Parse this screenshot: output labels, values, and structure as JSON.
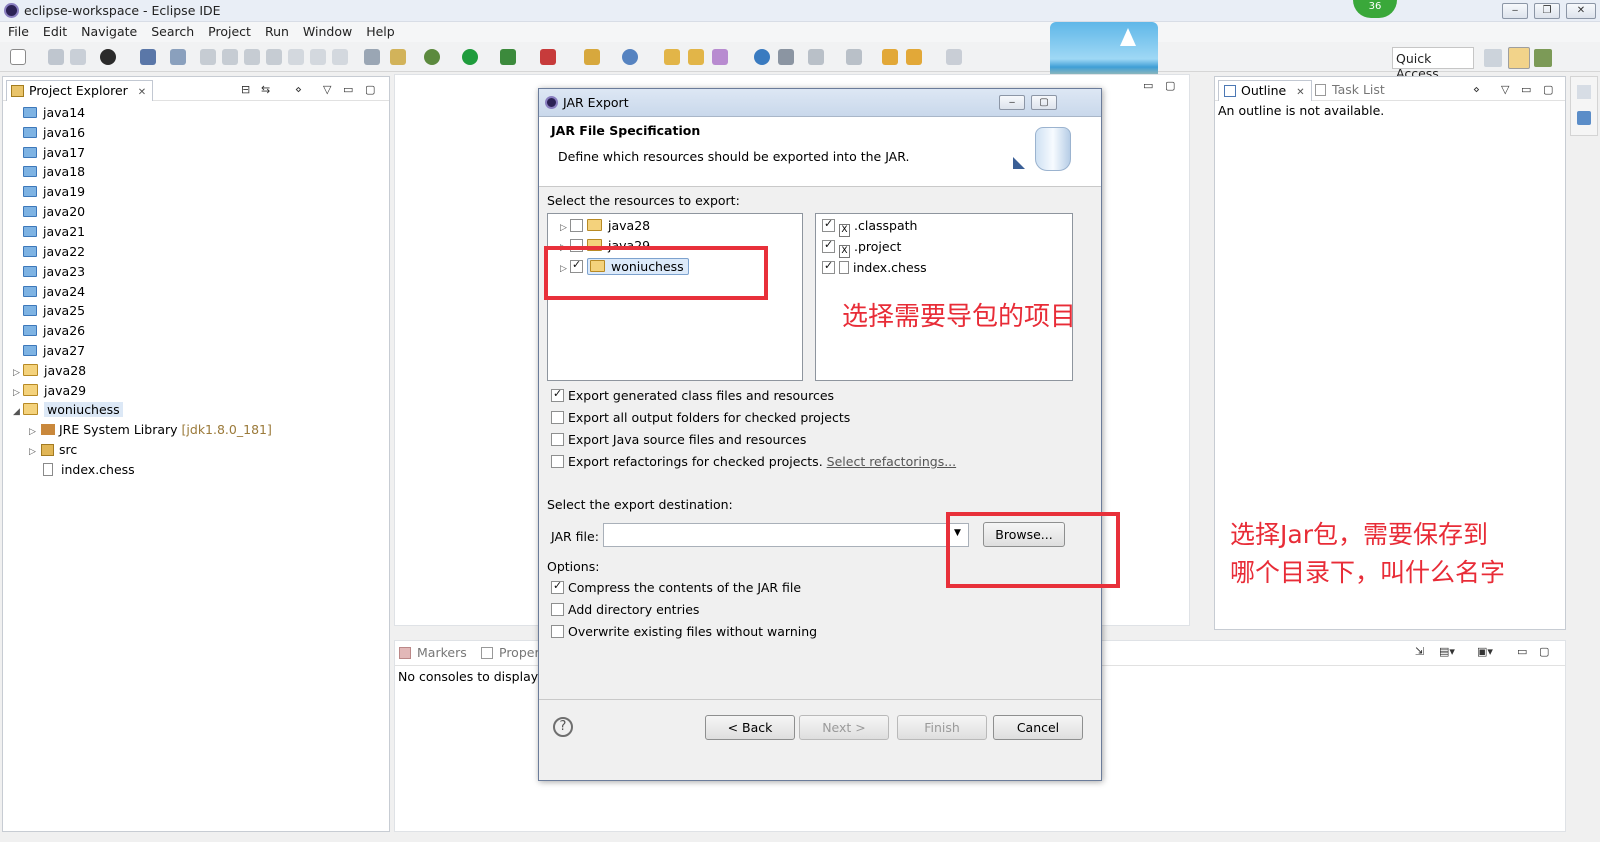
{
  "window": {
    "title": "eclipse-workspace - Eclipse IDE",
    "badge": "36"
  },
  "menu": [
    "File",
    "Edit",
    "Navigate",
    "Search",
    "Project",
    "Run",
    "Window",
    "Help"
  ],
  "toolbar": {
    "quick_access": "Quick Access"
  },
  "project_explorer": {
    "tab": "Project Explorer",
    "items": [
      "java14",
      "java16",
      "java17",
      "java18",
      "java19",
      "java20",
      "java21",
      "java22",
      "java23",
      "java24",
      "java25",
      "java26",
      "java27",
      "java28",
      "java29",
      "woniuchess"
    ],
    "children": [
      {
        "label": "JRE System Library",
        "extra": "[jdk1.8.0_181]"
      },
      {
        "label": "src"
      },
      {
        "label": "index.chess"
      }
    ]
  },
  "outline": {
    "tab": "Outline",
    "tab2": "Task List",
    "message": "An outline is not available."
  },
  "bottom_panel": {
    "tab1": "Markers",
    "tab2": "Proper",
    "message": "No consoles to display a"
  },
  "dialog": {
    "title": "JAR Export",
    "heading": "JAR File Specification",
    "description": "Define which resources should be exported into the JAR.",
    "select_label": "Select the resources to export:",
    "left_tree": [
      {
        "label": "java28",
        "checked": false
      },
      {
        "label": "java29",
        "checked": false
      },
      {
        "label": "woniuchess",
        "checked": true
      }
    ],
    "right_list": [
      {
        "label": ".classpath",
        "checked": true
      },
      {
        "label": ".project",
        "checked": true
      },
      {
        "label": "index.chess",
        "checked": true
      }
    ],
    "export_options": [
      {
        "label": "Export generated class files and resources",
        "checked": true
      },
      {
        "label": "Export all output folders for checked projects",
        "checked": false
      },
      {
        "label": "Export Java source files and resources",
        "checked": false
      },
      {
        "label": "Export refactorings for checked projects.",
        "checked": false,
        "link": "Select refactorings..."
      }
    ],
    "destination_label": "Select the export destination:",
    "jar_file_label": "JAR file:",
    "jar_file_value": "",
    "browse": "Browse...",
    "options_label": "Options:",
    "options": [
      {
        "label": "Compress the contents of the JAR file",
        "checked": true
      },
      {
        "label": "Add directory entries",
        "checked": false
      },
      {
        "label": "Overwrite existing files without warning",
        "checked": false
      }
    ],
    "buttons": {
      "back": "< Back",
      "next": "Next >",
      "finish": "Finish",
      "cancel": "Cancel"
    }
  },
  "annotations": {
    "a1": "选择需要导包的项目",
    "a2_line1": "选择Jar包，需要保存到",
    "a2_line2": "哪个目录下，叫什么名字"
  },
  "colors": {
    "annotation": "#e82c37",
    "selection": "#cde8ff"
  }
}
